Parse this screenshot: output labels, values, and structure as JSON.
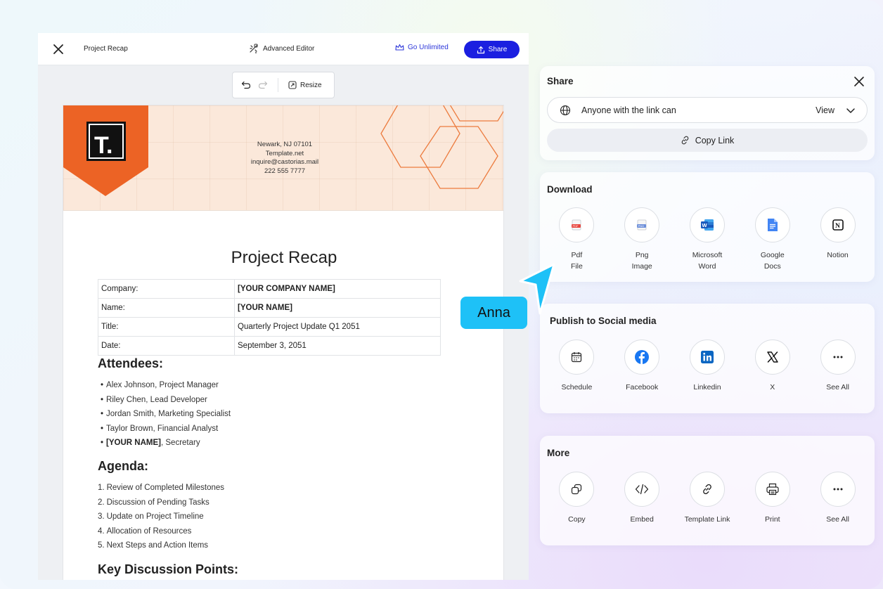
{
  "editor": {
    "doc_name": "Project Recap",
    "advanced_editor": "Advanced Editor",
    "go_unlimited": "Go Unlimited",
    "share": "Share",
    "resize": "Resize"
  },
  "document": {
    "banner": {
      "logo_letter": "T.",
      "contact_lines": [
        "Newark, NJ 07101",
        "Template.net",
        "inquire@castorias.mail",
        "222 555 7777"
      ]
    },
    "title": "Project Recap",
    "info_rows": [
      {
        "label": "Company:",
        "value": "[YOUR COMPANY NAME]",
        "bold": true
      },
      {
        "label": "Name:",
        "value": "[YOUR NAME]",
        "bold": true
      },
      {
        "label": "Title:",
        "value": "Quarterly Project Update Q1 2051",
        "bold": false
      },
      {
        "label": "Date:",
        "value": "September 3, 2051",
        "bold": false
      }
    ],
    "attendees_heading": "Attendees:",
    "attendees": [
      "Alex Johnson, Project Manager",
      "Riley Chen, Lead Developer",
      "Jordan Smith, Marketing Specialist",
      "Taylor Brown, Financial Analyst"
    ],
    "attendee_last_bold": "[YOUR NAME]",
    "attendee_last_rest": ", Secretary",
    "agenda_heading": "Agenda:",
    "agenda": [
      {
        "num": "1.",
        "text": "Review of Completed Milestones"
      },
      {
        "num": "2.",
        "text": "Discussion of Pending Tasks"
      },
      {
        "num": "3.",
        "text": "Update on Project Timeline"
      },
      {
        "num": "4.",
        "text": "Allocation of Resources"
      },
      {
        "num": "5.",
        "text": "Next Steps and Action Items"
      }
    ],
    "key_points_heading": "Key Discussion Points:"
  },
  "share_panel": {
    "title": "Share",
    "permission_text": "Anyone with the link can",
    "permission_value": "View",
    "copy_link": "Copy Link"
  },
  "download": {
    "title": "Download",
    "items": [
      {
        "label": "Pdf File",
        "icon": "pdf-icon"
      },
      {
        "label": "Png Image",
        "icon": "png-icon"
      },
      {
        "label": "Microsoft Word",
        "icon": "word-icon"
      },
      {
        "label": "Google Docs",
        "icon": "google-docs-icon"
      },
      {
        "label": "Notion",
        "icon": "notion-icon"
      }
    ]
  },
  "social": {
    "title": "Publish to Social media",
    "items": [
      {
        "label": "Schedule",
        "icon": "calendar-icon"
      },
      {
        "label": "Facebook",
        "icon": "facebook-icon"
      },
      {
        "label": "Linkedin",
        "icon": "linkedin-icon"
      },
      {
        "label": "X",
        "icon": "x-icon"
      },
      {
        "label": "See All",
        "icon": "more-icon"
      }
    ]
  },
  "more": {
    "title": "More",
    "items": [
      {
        "label": "Copy",
        "icon": "copy-icon"
      },
      {
        "label": "Embed",
        "icon": "embed-icon"
      },
      {
        "label": "Template Link",
        "icon": "link-icon"
      },
      {
        "label": "Print",
        "icon": "print-icon"
      },
      {
        "label": "See All",
        "icon": "more-icon"
      }
    ]
  },
  "cursor_tag": "Anna",
  "colors": {
    "share_button": "#1b1fe0",
    "go_unlimited": "#2b35d9",
    "banner_orange": "#ec6325",
    "banner_bg": "#fbe8da",
    "cursor_tag": "#1ec1f7"
  }
}
